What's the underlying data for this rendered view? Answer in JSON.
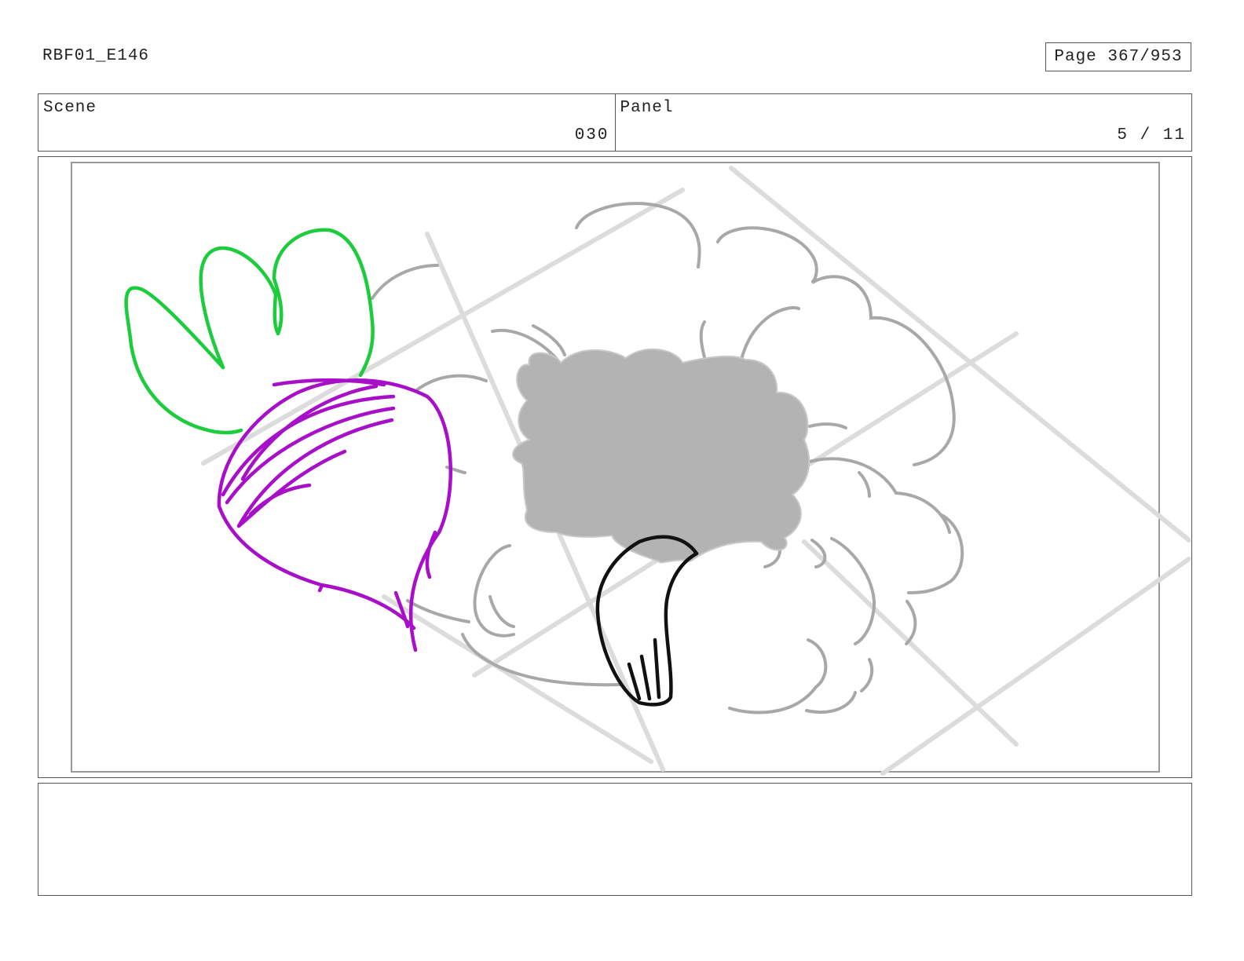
{
  "header": {
    "doc_id": "RBF01_E146",
    "page_label": "Page 367/953"
  },
  "scene": {
    "label": "Scene",
    "value": "030"
  },
  "panel": {
    "label": "Panel",
    "value": "5 / 11"
  },
  "sketch": {
    "colors": {
      "leaves": "#1ccc3c",
      "bulb": "#a80fc8",
      "hand": "#111111",
      "smoke_fill": "#b3b3b3",
      "smoke_line": "#a8a8a8",
      "floor_line": "#d9d9d9",
      "safe_frame": "#999999"
    },
    "icons": [
      "radish-drawing",
      "smoke-cloud-drawing",
      "hand-drawing"
    ]
  },
  "notes": {
    "text": ""
  }
}
